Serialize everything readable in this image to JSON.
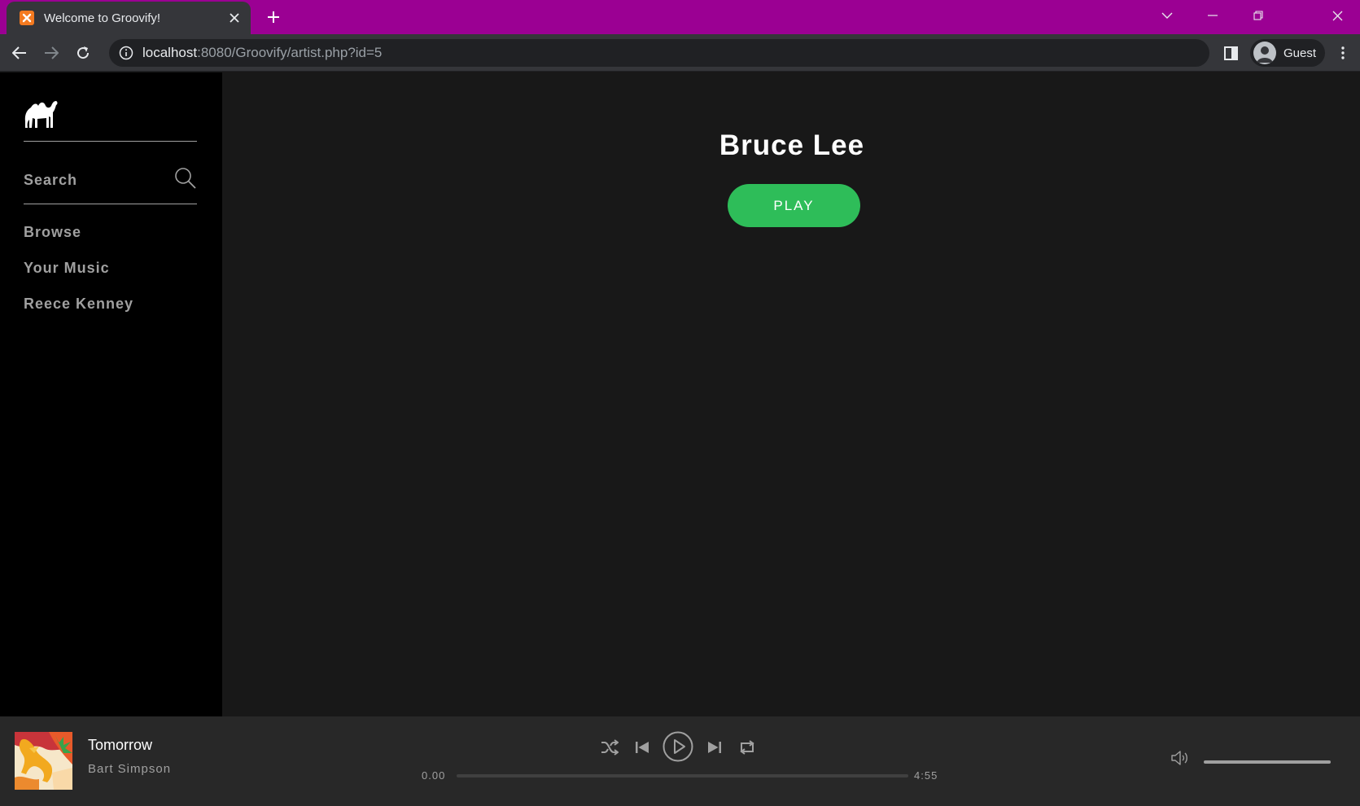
{
  "browser": {
    "tab_title": "Welcome to Groovify!",
    "url_host": "localhost",
    "url_rest": ":8080/Groovify/artist.php?id=5",
    "profile_label": "Guest",
    "frame_color": "#9b0093"
  },
  "sidebar": {
    "search_label": "Search",
    "items": [
      {
        "label": "Browse"
      },
      {
        "label": "Your Music"
      },
      {
        "label": "Reece Kenney"
      }
    ]
  },
  "artist": {
    "name": "Bruce Lee",
    "play_label": "PLAY",
    "accent_color": "#2ebd59"
  },
  "player": {
    "track_name": "Tomorrow",
    "track_artist": "Bart Simpson",
    "current_time": "0.00",
    "duration": "4:55",
    "progress": 0,
    "volume": 1.0
  }
}
